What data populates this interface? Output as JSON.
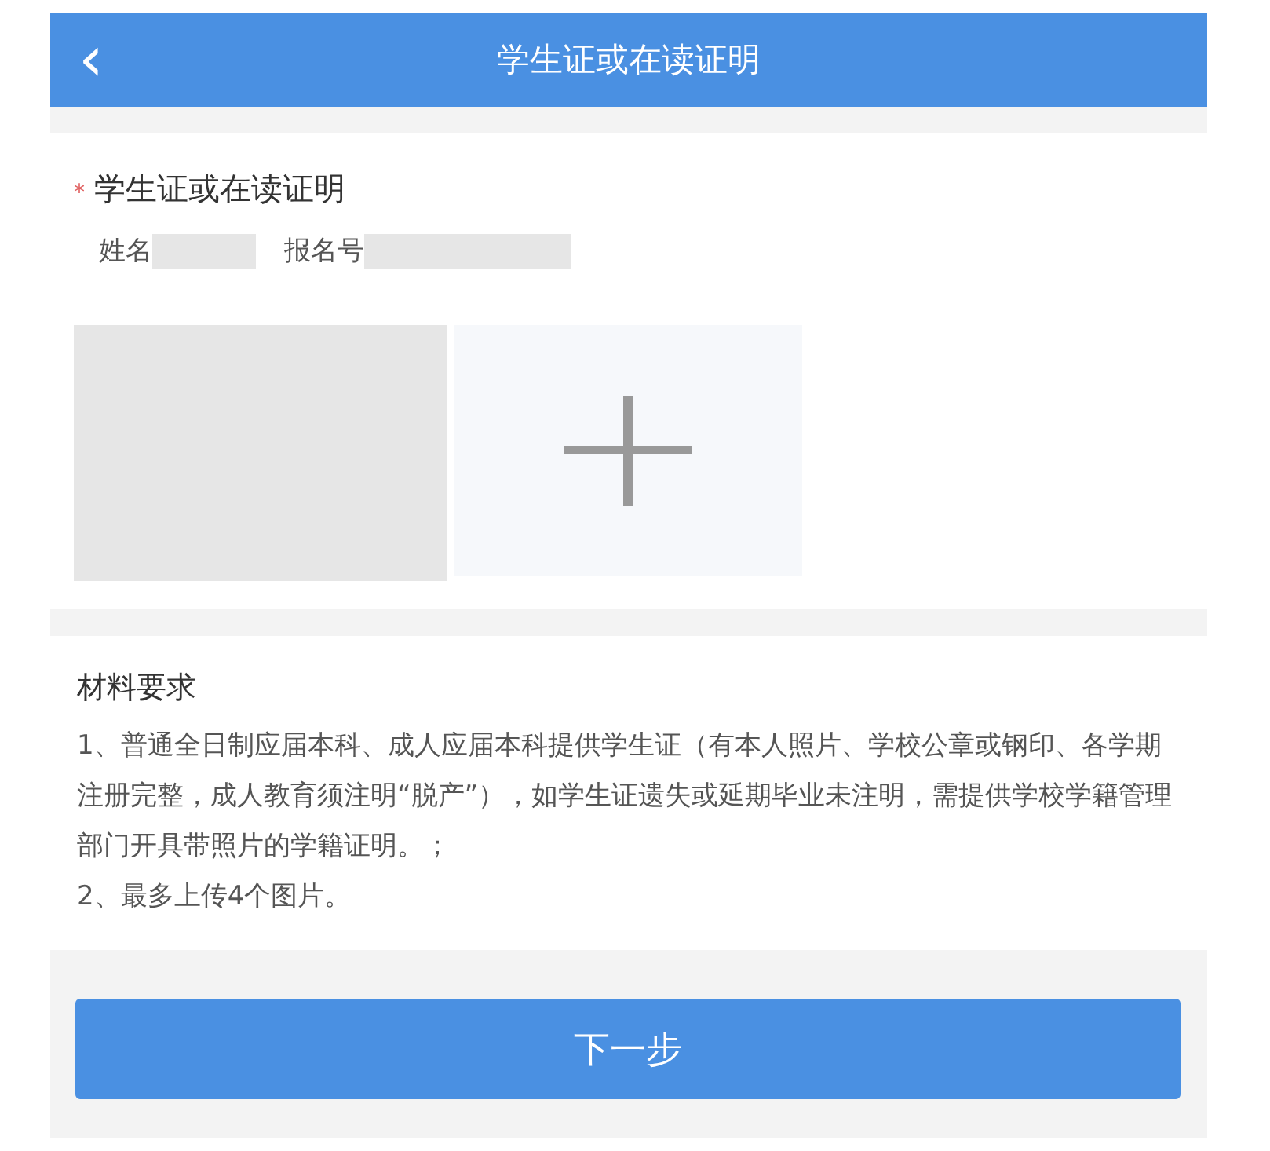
{
  "header": {
    "back_icon": "‹",
    "title": "学生证或在读证明"
  },
  "upload": {
    "required_mark": "*",
    "title": "学生证或在读证明",
    "fields": [
      {
        "label": "姓名",
        "redacted": true
      },
      {
        "label": "报名号",
        "redacted": true
      }
    ],
    "photos": [
      {
        "kind": "redacted"
      },
      {
        "kind": "add"
      }
    ]
  },
  "requirements": {
    "title": "材料要求",
    "items": [
      "1、普通全日制应届本科、成人应届本科提供学生证（有本人照片、学校公章或钢印、各学期注册完整，成人教育须注明“脱产”），如学生证遗失或延期毕业未注明，需提供学校学籍管理部门开具带照片的学籍证明。；",
      "2、最多上传4个图片。"
    ]
  },
  "next_button": "下一步"
}
